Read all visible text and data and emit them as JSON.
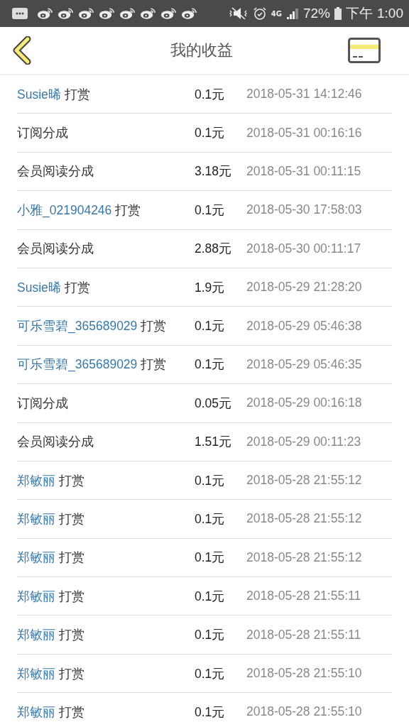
{
  "status_bar": {
    "notifications": [
      {
        "kind": "message"
      },
      {
        "kind": "social"
      },
      {
        "kind": "social"
      },
      {
        "kind": "social"
      },
      {
        "kind": "social"
      },
      {
        "kind": "social"
      },
      {
        "kind": "social"
      },
      {
        "kind": "social"
      },
      {
        "kind": "social"
      }
    ],
    "network": "4G",
    "battery": "72%",
    "period": "下午",
    "time": "1:00"
  },
  "header": {
    "title": "我的收益"
  },
  "rows": [
    {
      "kind": "tip",
      "user": "Susie晞",
      "label": "打赏",
      "amount": "0.1元",
      "time": "2018-05-31 14:12:46"
    },
    {
      "kind": "income",
      "label": "订阅分成",
      "amount": "0.1元",
      "time": "2018-05-31 00:16:16"
    },
    {
      "kind": "income",
      "label": "会员阅读分成",
      "amount": "3.18元",
      "time": "2018-05-31 00:11:15"
    },
    {
      "kind": "tip",
      "user": "小雅_021904246",
      "label": "打赏",
      "amount": "0.1元",
      "time": "2018-05-30 17:58:03"
    },
    {
      "kind": "income",
      "label": "会员阅读分成",
      "amount": "2.88元",
      "time": "2018-05-30 00:11:17"
    },
    {
      "kind": "tip",
      "user": "Susie晞",
      "label": "打赏",
      "amount": "1.9元",
      "time": "2018-05-29 21:28:20"
    },
    {
      "kind": "tip",
      "user": "可乐雪碧_365689029",
      "label": "打赏",
      "amount": "0.1元",
      "time": "2018-05-29 05:46:38"
    },
    {
      "kind": "tip",
      "user": "可乐雪碧_365689029",
      "label": "打赏",
      "amount": "0.1元",
      "time": "2018-05-29 05:46:35"
    },
    {
      "kind": "income",
      "label": "订阅分成",
      "amount": "0.05元",
      "time": "2018-05-29 00:16:18"
    },
    {
      "kind": "income",
      "label": "会员阅读分成",
      "amount": "1.51元",
      "time": "2018-05-29 00:11:23"
    },
    {
      "kind": "tip",
      "user": "郑敏丽",
      "label": "打赏",
      "amount": "0.1元",
      "time": "2018-05-28 21:55:12"
    },
    {
      "kind": "tip",
      "user": "郑敏丽",
      "label": "打赏",
      "amount": "0.1元",
      "time": "2018-05-28 21:55:12"
    },
    {
      "kind": "tip",
      "user": "郑敏丽",
      "label": "打赏",
      "amount": "0.1元",
      "time": "2018-05-28 21:55:12"
    },
    {
      "kind": "tip",
      "user": "郑敏丽",
      "label": "打赏",
      "amount": "0.1元",
      "time": "2018-05-28 21:55:11"
    },
    {
      "kind": "tip",
      "user": "郑敏丽",
      "label": "打赏",
      "amount": "0.1元",
      "time": "2018-05-28 21:55:11"
    },
    {
      "kind": "tip",
      "user": "郑敏丽",
      "label": "打赏",
      "amount": "0.1元",
      "time": "2018-05-28 21:55:10"
    },
    {
      "kind": "tip",
      "user": "郑敏丽",
      "label": "打赏",
      "amount": "0.1元",
      "time": "2018-05-28 21:55:10"
    }
  ]
}
